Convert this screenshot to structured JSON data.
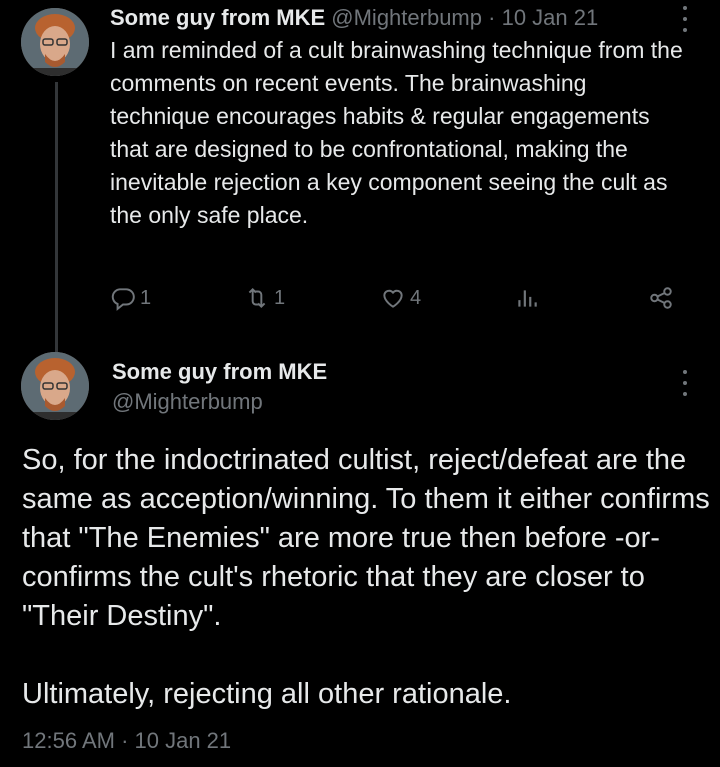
{
  "tweet1": {
    "author_name": "Some guy from MKE",
    "handle": "@Mighterbump",
    "separator": "·",
    "date": "10 Jan 21",
    "text": "I am reminded of a cult brainwashing technique from the comments on recent events. The brainwashing technique encourages habits & regular engagements that are designed to be confrontational, making the inevitable rejection a key component seeing the cult as the only safe place.",
    "replies": "1",
    "reposts": "1",
    "likes": "4"
  },
  "tweet2": {
    "author_name": "Some guy from MKE",
    "handle": "@Mighterbump",
    "paragraph1": "So, for the indoctrinated cultist, reject/defeat are the same as acception/winning. To them it either confirms that \"The Enemies\" are more true then before -or- confirms the cult's rhetoric that they are closer to \"Their Destiny\".",
    "paragraph2": "Ultimately, rejecting all other rationale.",
    "timestamp": "12:56 AM · 10 Jan 21"
  },
  "icons": {
    "reply": "reply-icon",
    "repost": "repost-icon",
    "like": "like-icon",
    "views": "views-icon",
    "share": "share-icon",
    "more": "more-icon"
  },
  "colors": {
    "background": "#000000",
    "text": "#e7e9ea",
    "muted": "#71767b",
    "thread_line": "#333639"
  }
}
